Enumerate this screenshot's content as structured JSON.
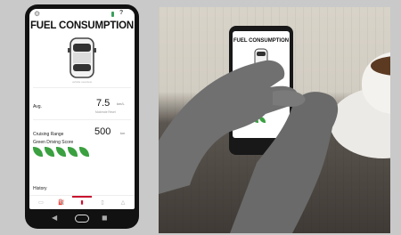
{
  "phone_app": {
    "status": {
      "settings_icon": "gear-icon",
      "help_label": "?",
      "battery_color": "#3aa05a"
    },
    "title": "FUEL CONSUMPTION",
    "car_caption": "vehicle overview",
    "avg": {
      "label": "Avg.",
      "value": "7.5",
      "unit": "km/L",
      "note": "Moderate Reset"
    },
    "cruising_range": {
      "label": "Cruising Range",
      "value": "500",
      "unit": "km"
    },
    "green_driving": {
      "label": "Green Driving Score",
      "leaves_filled": 5,
      "leaves_total": 5,
      "color": "#3aa040"
    },
    "history_label": "History",
    "tabs": [
      {
        "icon": "map-icon",
        "symbol": "▭"
      },
      {
        "icon": "fuel-icon",
        "symbol": "⛽"
      },
      {
        "icon": "chart-icon",
        "symbol": "▮",
        "active": true
      },
      {
        "icon": "battery-icon",
        "symbol": "▯"
      },
      {
        "icon": "bell-icon",
        "symbol": "△"
      }
    ],
    "accent_color": "#c8102e",
    "nav": {
      "back": "◀",
      "recent": "◼"
    }
  },
  "photo": {
    "phone_title": "FUEL CONSUMPTION"
  }
}
